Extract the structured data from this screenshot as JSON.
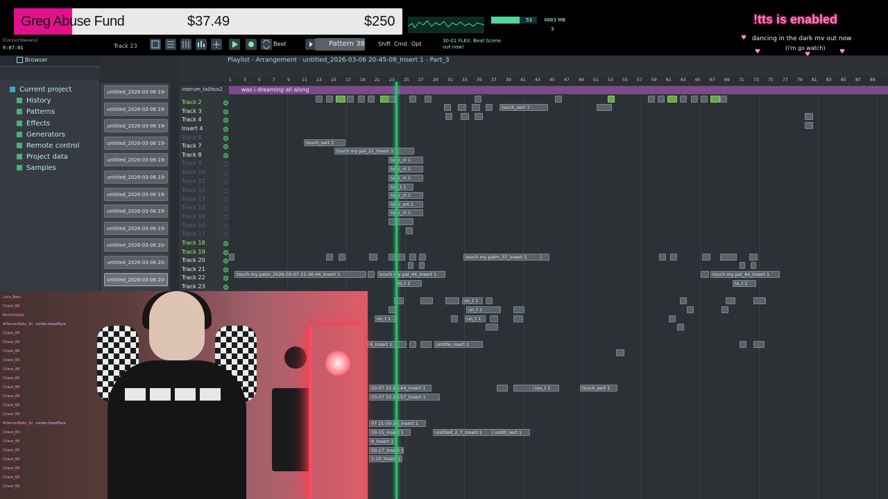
{
  "fund": {
    "name": "Greg Abuse Fund",
    "raised": "$37.49",
    "goal": "$250"
  },
  "corner": {
    "user": "[ConnorStevens]",
    "time": "9:07:01"
  },
  "toolbar": {
    "track_selector": "Track 23",
    "beat_label": "Beat",
    "pattern_label": "Pattern 38",
    "shift": "Shift",
    "cmd": "Cmd",
    "opt": "Opt",
    "hint": "30-01 FLEX: Beat Scene out now!",
    "cpu": "53",
    "memory": "4683 MB",
    "polyphony": "3",
    "cpu_level": 0.62
  },
  "overlay": {
    "tts": "!tts is enabled",
    "song_line1": "dancing in the dark mv out now",
    "song_line2": "(i'm go watch)"
  },
  "browser": {
    "title": "Browser",
    "items": [
      {
        "label": "Current project",
        "root": true
      },
      {
        "label": "History"
      },
      {
        "label": "Patterns"
      },
      {
        "label": "Effects"
      },
      {
        "label": "Generators"
      },
      {
        "label": "Remote control"
      },
      {
        "label": "Project data"
      },
      {
        "label": "Samples"
      }
    ]
  },
  "playlist": {
    "breadcrumb": "Playlist · Arrangement · untitled_2026-03-06 20-45-08_Insert 1 - Part_3",
    "patterns": [
      "untitled_2026-03-06 19-",
      "untitled_2026-03-06 19-",
      "untitled_2026-03-06 19-",
      "untitled_2026-03-06 19-",
      "untitled_2026-03-06 19-",
      "untitled_2026-03-06 19-",
      "untitled_2026-03-06 19-",
      "untitled_2026-03-06 19-",
      "untitled_2026-03-06 19-",
      "untitled_2026-03-06 20-",
      "untitled_2026-03-06 20-",
      "untitled_2026-03-06 20-"
    ],
    "top_clip_track": "instrum_tal/bus2",
    "top_clip_label": "was i dreaming all along",
    "ruler": [
      "1",
      "3",
      "5",
      "7",
      "9",
      "11",
      "13",
      "15",
      "17",
      "19",
      "21",
      "23",
      "25",
      "27",
      "29",
      "31",
      "33",
      "35",
      "37",
      "39",
      "41",
      "43",
      "45",
      "47",
      "49",
      "51",
      "53",
      "55",
      "57",
      "59",
      "61",
      "63",
      "65",
      "67",
      "69",
      "71",
      "73",
      "75",
      "77",
      "79",
      "81",
      "83",
      "85",
      "87",
      "89"
    ],
    "tracks": [
      {
        "name": "Track 2",
        "style": "green",
        "led": true
      },
      {
        "name": "Track 3",
        "style": "",
        "led": true
      },
      {
        "name": "Track 4",
        "style": "",
        "led": true
      },
      {
        "name": "Insert 4",
        "style": "",
        "led": true
      },
      {
        "name": "Track 6",
        "style": "dim",
        "led": true
      },
      {
        "name": "Track 7",
        "style": "",
        "led": true
      },
      {
        "name": "Track 8",
        "style": "",
        "led": true
      },
      {
        "name": "Track 9",
        "style": "dim",
        "led": false
      },
      {
        "name": "Track 10",
        "style": "dim",
        "led": false
      },
      {
        "name": "Track 11",
        "style": "dim",
        "led": false
      },
      {
        "name": "Track 12",
        "style": "dim",
        "led": false
      },
      {
        "name": "Track 13",
        "style": "dim",
        "led": false
      },
      {
        "name": "Track 14",
        "style": "dim",
        "led": false
      },
      {
        "name": "Track 15",
        "style": "dim",
        "led": false
      },
      {
        "name": "Track 16",
        "style": "dim",
        "led": false
      },
      {
        "name": "Track 17",
        "style": "dim",
        "led": false
      },
      {
        "name": "Track 18",
        "style": "green",
        "led": true
      },
      {
        "name": "Track 19",
        "style": "green",
        "led": true
      },
      {
        "name": "Track 20",
        "style": "",
        "led": true
      },
      {
        "name": "Track 21",
        "style": "",
        "led": true
      },
      {
        "name": "Track 22",
        "style": "",
        "led": true
      },
      {
        "name": "Track 23",
        "style": "",
        "led": true
      }
    ],
    "clip_labels": {
      "touch_sert": "touch_sert 1",
      "touch_palm_21": "touch my pal_21_Insert 1",
      "touc_rt": "touc_rt 1",
      "tou_t": "tou_t 1",
      "touc_ert": "touc_ert 1",
      "touch_palm_37": "touch my palm_37_Insert 1",
      "touch_palm_long": "touch my palm_2026-03-07 21-36-44_Insert 1",
      "touch_pal_44": "touch my pal_44_Insert 1",
      "to_t": "to_t 1",
      "un_t": "un_t 1",
      "untitle_nsert": "untitle_nsert 1",
      "insert_22_44": "03-07 22-22-44_Insert 1",
      "insert_24_57": "03-07 22-24-57_Insert 1",
      "insert_50_38": "07 21-50-38_Insert 1",
      "insert_59_15": "59-15_Insert 1",
      "insert_8": "8_Insert 1",
      "insert_17": "00-17_Insert 1",
      "insert_10": "1-10_Insert 1",
      "untitled_7": "untitled_2_7_Insert 1",
      "untitl_sert": "untitl_sert 1",
      "tou_t2": "tou_t 1",
      "touch_sert2": "touch_sert 1"
    }
  },
  "chat": {
    "lines": [
      {
        "name": "Luca_Bass",
        "text": ""
      },
      {
        "name": "Chase_BK",
        "text": ""
      },
      {
        "name": "NicoleSkylar",
        "text": ""
      },
      {
        "name": "#DemonBaby_6s",
        "text": "combo bwpdFace"
      },
      {
        "name": "Chase_BK",
        "text": ""
      },
      {
        "name": "Chase_BK",
        "text": ""
      },
      {
        "name": "Chase_BK",
        "text": ""
      },
      {
        "name": "Chase_BK",
        "text": ""
      },
      {
        "name": "Chase_BK",
        "text": ""
      },
      {
        "name": "Chase_BK",
        "text": ""
      },
      {
        "name": "Chase_BK",
        "text": ""
      },
      {
        "name": "Chase_BK",
        "text": ""
      },
      {
        "name": "Chase_BK",
        "text": ""
      },
      {
        "name": "Chase_BK",
        "text": ""
      },
      {
        "name": "#DemonBaby_6s",
        "text": "combo bwpdFace"
      },
      {
        "name": "Chase_BK",
        "text": ""
      },
      {
        "name": "Chase_BK",
        "text": ""
      },
      {
        "name": "Chase_BK",
        "text": ""
      },
      {
        "name": "Chase_BK",
        "text": ""
      },
      {
        "name": "Chase_BK",
        "text": ""
      },
      {
        "name": "Chase_BK",
        "text": ""
      },
      {
        "name": "Chase_BK",
        "text": ""
      }
    ]
  },
  "icons": {
    "browser": "browser-icon",
    "play": "play-icon",
    "record": "record-icon"
  },
  "colors": {
    "accent_green": "#27c06a",
    "fund_pink": "#e3108c",
    "tts_pink": "#ff7fb8"
  }
}
